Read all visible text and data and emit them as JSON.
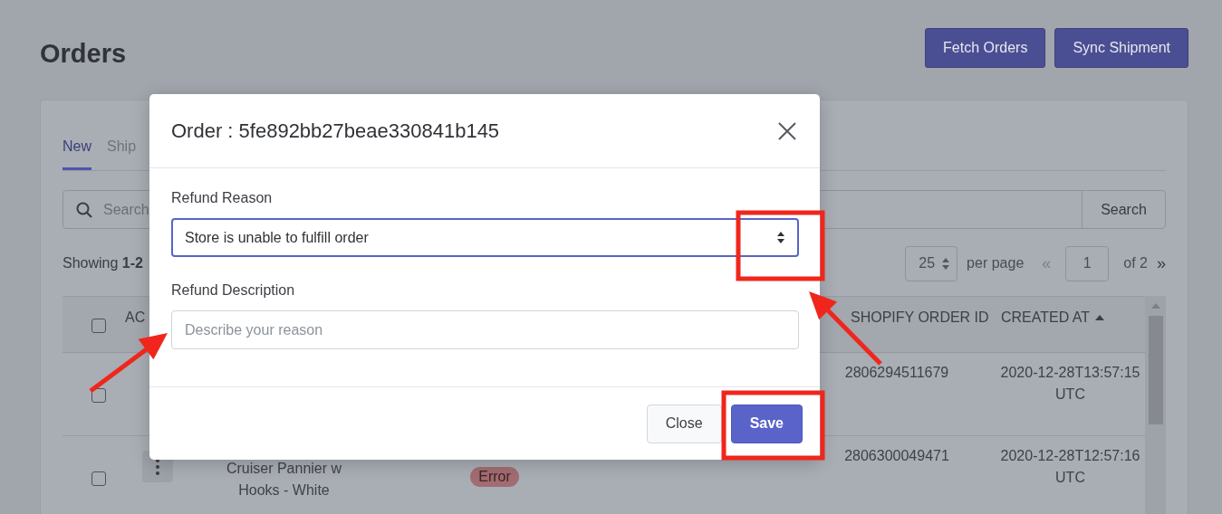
{
  "page": {
    "title": "Orders",
    "actions": [
      "Fetch Orders",
      "Sync Shipment"
    ]
  },
  "tabs": [
    {
      "label": "New",
      "selected": true
    },
    {
      "label": "Ship",
      "selected": false
    }
  ],
  "search": {
    "placeholder": "Search",
    "button": "Search"
  },
  "summary": "Showing **1-2**",
  "pagination": {
    "per_page": "25",
    "per_page_label": "per page",
    "first": "«",
    "page": "1",
    "of": "of 2",
    "last": "»"
  },
  "table": {
    "select_all": {
      "checked": false
    },
    "columns": [
      {
        "label": "AC"
      },
      {
        "label": "SHOPIFY ORDER ID",
        "sorted": false
      },
      {
        "label": "CREATED AT",
        "sorted": true
      }
    ],
    "rows": [
      {
        "checked": false,
        "shopify_order_id": "2806294511679",
        "created_at": "2020-12-28T13:57:15 UTC"
      },
      {
        "checked": false,
        "product": "Cruiser Pannier w Hooks - White",
        "status": "Error",
        "shopify_order_id": "2806300049471",
        "created_at": "2020-12-28T12:57:16 UTC"
      }
    ]
  },
  "modal": {
    "title": "Order : 5fe892bb27beae330841b145",
    "fields": [
      {
        "kind": "select",
        "label": "Refund Reason",
        "value": "Store is unable to fulfill order",
        "focused": true
      },
      {
        "kind": "text",
        "label": "Refund Description",
        "placeholder": "Describe your reason",
        "focused": false
      }
    ],
    "buttons": [
      {
        "label": "Close",
        "primary": false
      },
      {
        "label": "Save",
        "primary": true
      }
    ]
  }
}
